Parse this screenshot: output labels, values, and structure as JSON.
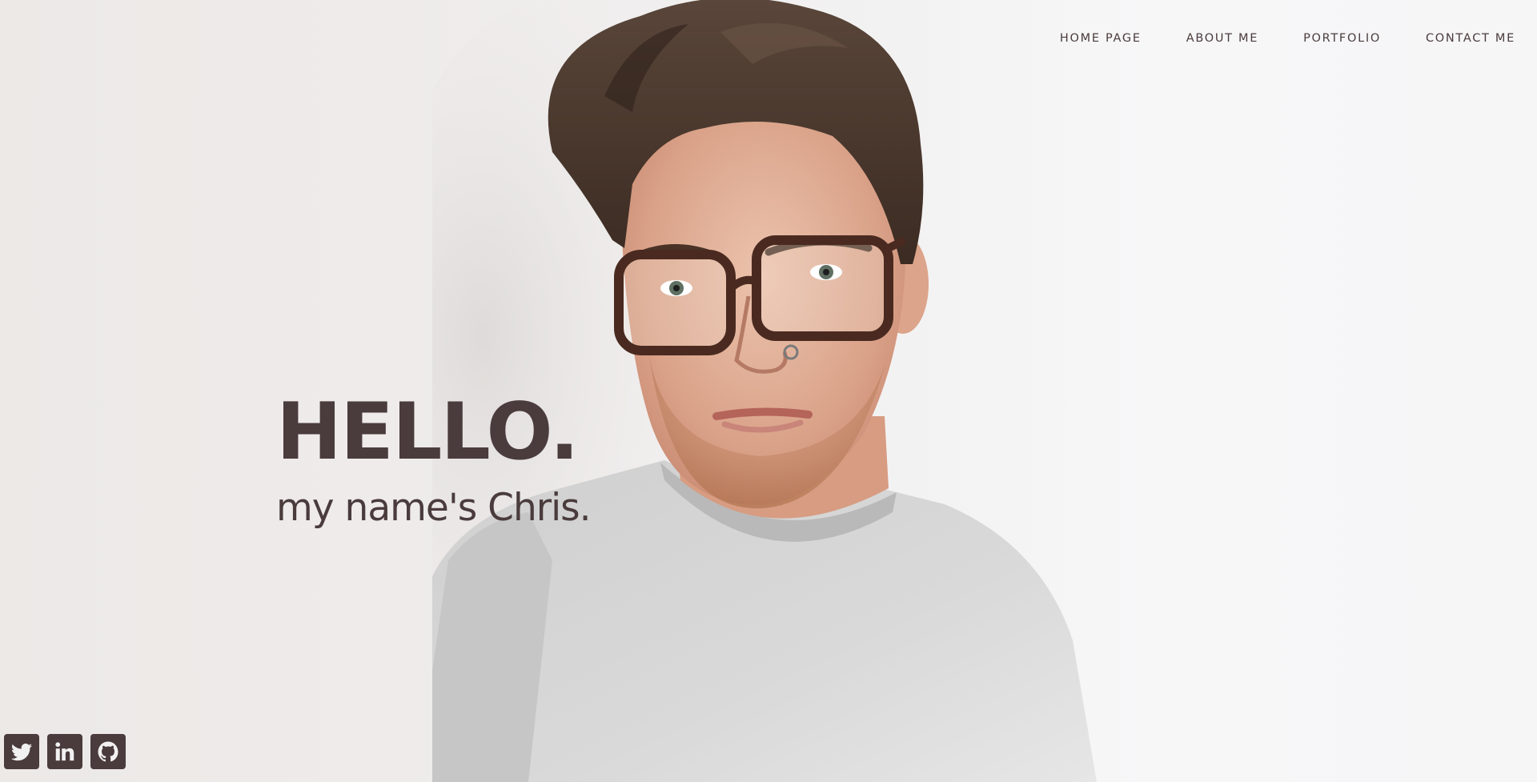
{
  "nav": {
    "items": [
      {
        "label": "HOME PAGE"
      },
      {
        "label": "ABOUT ME"
      },
      {
        "label": "PORTFOLIO"
      },
      {
        "label": "CONTACT ME"
      }
    ]
  },
  "hero": {
    "title": "HELLO.",
    "subtitle": "my name's Chris."
  },
  "social": {
    "icons": [
      "twitter-icon",
      "linkedin-icon",
      "github-icon"
    ]
  },
  "colors": {
    "text": "#4a3b3c",
    "background": "#f2f1f1",
    "shirt": "#cfcfcf",
    "hair": "#4b3a30"
  }
}
